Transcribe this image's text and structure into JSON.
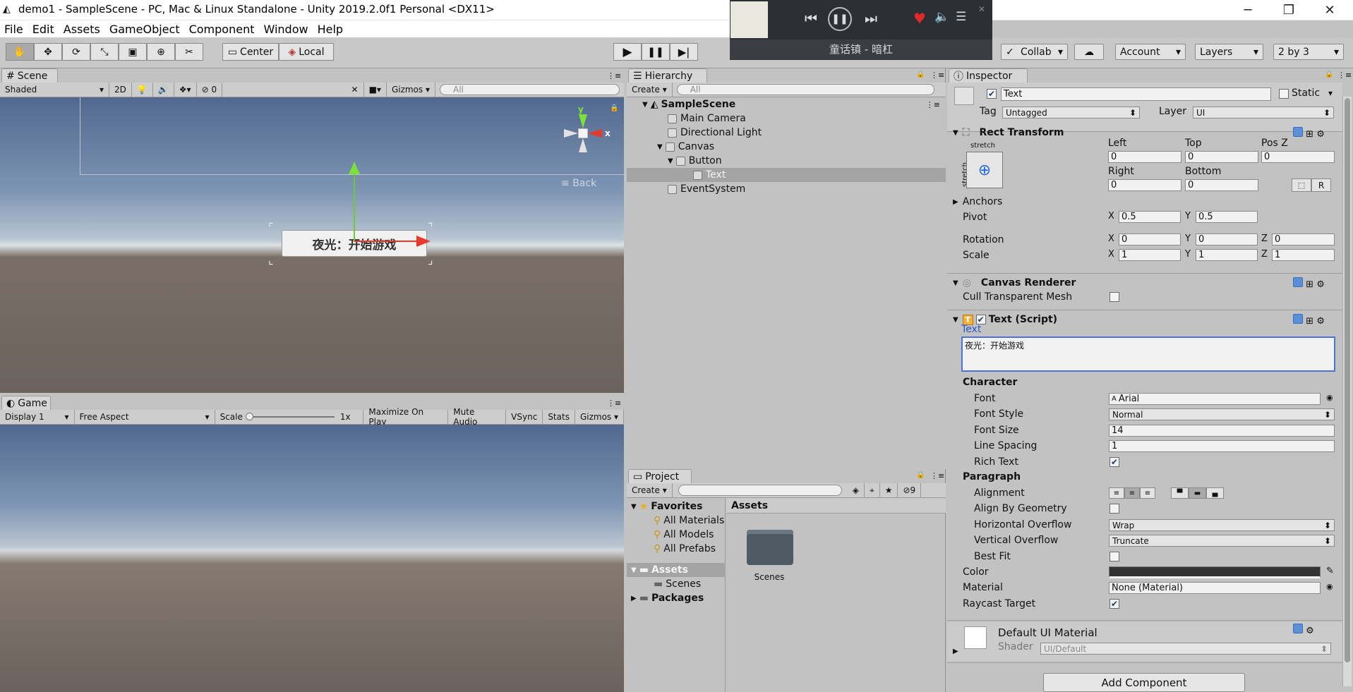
{
  "window": {
    "title": "demo1 - SampleScene - PC, Mac & Linux Standalone - Unity 2019.2.0f1 Personal <DX11>",
    "min": "─",
    "max": "❐",
    "close": "✕"
  },
  "menu": [
    "File",
    "Edit",
    "Assets",
    "GameObject",
    "Component",
    "Window",
    "Help"
  ],
  "toolbar": {
    "pivot": "Center",
    "space": "Local",
    "collab": "Collab",
    "account": "Account",
    "layers": "Layers",
    "layout": "2 by 3"
  },
  "player": {
    "song": "童话镇 - 暗杠"
  },
  "scene": {
    "tab": "Scene",
    "shading": "Shaded",
    "mode2d": "2D",
    "hidden_count": "0",
    "gizmos": "Gizmos",
    "search_placeholder": "All",
    "button_text": "夜光：开始游戏",
    "axis_y": "y",
    "axis_x": "x",
    "back": "Back"
  },
  "game": {
    "tab": "Game",
    "display": "Display 1",
    "aspect": "Free Aspect",
    "scale_label": "Scale",
    "scale_value": "1x",
    "maximize": "Maximize On Play",
    "mute": "Mute Audio",
    "vsync": "VSync",
    "stats": "Stats",
    "gizmos": "Gizmos"
  },
  "hierarchy": {
    "tab": "Hierarchy",
    "create": "Create",
    "search_placeholder": "All",
    "scene": "SampleScene",
    "items": [
      "Main Camera",
      "Directional Light",
      "Canvas",
      "Button",
      "Text",
      "EventSystem"
    ]
  },
  "project": {
    "tab": "Project",
    "create": "Create",
    "hidden_count": "9",
    "favorites": "Favorites",
    "fav_items": [
      "All Materials",
      "All Models",
      "All Prefabs"
    ],
    "assets": "Assets",
    "scenes": "Scenes",
    "packages": "Packages",
    "grid_header": "Assets",
    "folder": "Scenes"
  },
  "inspector": {
    "tab": "Inspector",
    "name": "Text",
    "static": "Static",
    "tag_label": "Tag",
    "tag": "Untagged",
    "layer_label": "Layer",
    "layer": "UI",
    "rect": {
      "title": "Rect Transform",
      "stretch_top": "stretch",
      "stretch_side": "stretch",
      "left_l": "Left",
      "top_l": "Top",
      "posz_l": "Pos Z",
      "left": "0",
      "top": "0",
      "posz": "0",
      "right_l": "Right",
      "bottom_l": "Bottom",
      "right": "0",
      "bottom": "0",
      "r_btn": "R",
      "anchors": "Anchors",
      "pivot_l": "Pivot",
      "pivot_x": "0.5",
      "pivot_y": "0.5",
      "rotation_l": "Rotation",
      "rot_x": "0",
      "rot_y": "0",
      "rot_z": "0",
      "scale_l": "Scale",
      "sc_x": "1",
      "sc_y": "1",
      "sc_z": "1",
      "x": "X",
      "y": "Y",
      "z": "Z"
    },
    "canvas_renderer": {
      "title": "Canvas Renderer",
      "cull": "Cull Transparent Mesh"
    },
    "text_script": {
      "title": "Text (Script)",
      "text_label": "Text",
      "text_value": "夜光：开始游戏",
      "character": "Character",
      "font_l": "Font",
      "font": "Arial",
      "style_l": "Font Style",
      "style": "Normal",
      "size_l": "Font Size",
      "size": "14",
      "spacing_l": "Line Spacing",
      "spacing": "1",
      "rich_l": "Rich Text",
      "paragraph": "Paragraph",
      "align_l": "Alignment",
      "abg_l": "Align By Geometry",
      "hover_l": "Horizontal Overflow",
      "hover": "Wrap",
      "vover_l": "Vertical Overflow",
      "vover": "Truncate",
      "bestfit_l": "Best Fit",
      "color_l": "Color",
      "material_l": "Material",
      "material": "None (Material)",
      "raycast_l": "Raycast Target"
    },
    "material": {
      "title": "Default UI Material",
      "shader_l": "Shader",
      "shader": "UI/Default"
    },
    "add_component": "Add Component"
  },
  "colors": {
    "sky_top": "#5b7199",
    "horizon": "#c9d2dc",
    "ground": "#6e655f",
    "accent_blue": "#2457d6"
  }
}
